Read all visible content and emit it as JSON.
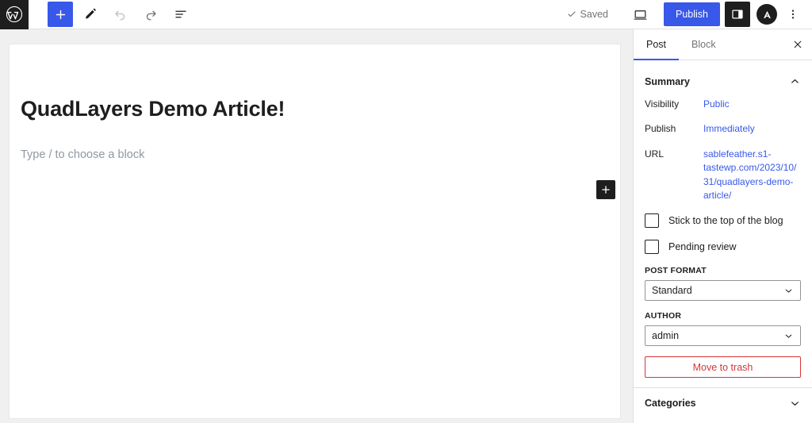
{
  "toolbar": {
    "wp_logo": "wordpress-logo",
    "add_block_label": "Toggle block inserter",
    "tools_label": "Tools",
    "undo_label": "Undo",
    "redo_label": "Redo",
    "list_view_label": "Document Overview",
    "saved_status": "Saved",
    "preview_label": "Preview",
    "publish_label": "Publish",
    "settings_label": "Settings",
    "plugin_label": "A",
    "options_label": "Options"
  },
  "editor": {
    "post_title": "QuadLayers Demo Article!",
    "block_placeholder": "Type / to choose a block",
    "inline_adder_label": "Add block"
  },
  "sidebar": {
    "tabs": [
      {
        "label": "Post",
        "active": true
      },
      {
        "label": "Block",
        "active": false
      }
    ],
    "close_label": "Close settings",
    "summary": {
      "title": "Summary",
      "rows": [
        {
          "label": "Visibility",
          "value": "Public"
        },
        {
          "label": "Publish",
          "value": "Immediately"
        },
        {
          "label": "URL",
          "value": "sablefeather.s1-tastewp.com/2023/10/31/quadlayers-demo-article/"
        }
      ]
    },
    "checkboxes": [
      {
        "label": "Stick to the top of the blog",
        "checked": false
      },
      {
        "label": "Pending review",
        "checked": false
      }
    ],
    "post_format": {
      "label": "POST FORMAT",
      "value": "Standard"
    },
    "author": {
      "label": "AUTHOR",
      "value": "admin"
    },
    "trash_label": "Move to trash",
    "categories_title": "Categories"
  },
  "colors": {
    "accent": "#3858e9",
    "danger": "#d63638",
    "dark": "#1e1e1e",
    "muted": "#757575"
  }
}
